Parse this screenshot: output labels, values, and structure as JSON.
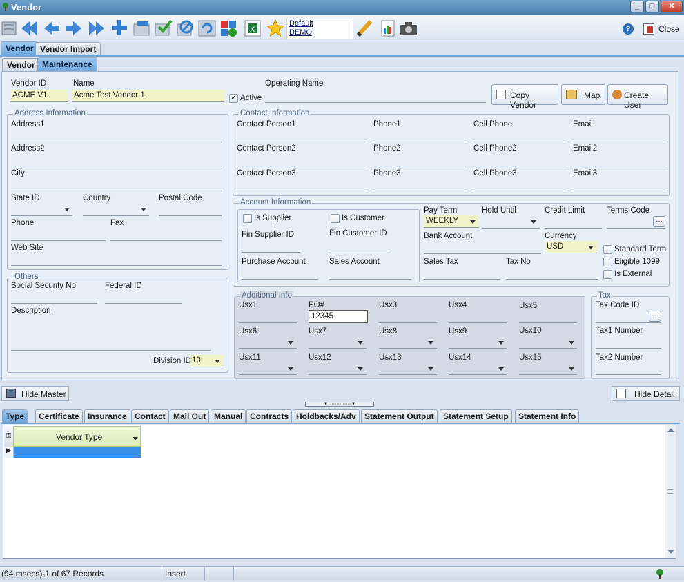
{
  "window": {
    "title": "Vendor"
  },
  "toolbar": {
    "icons": [
      "save-icon",
      "first-record-icon",
      "previous-record-icon",
      "next-record-icon",
      "last-record-icon",
      "add-record-icon",
      "delete-record-icon",
      "post-icon",
      "cancel-icon",
      "refresh-icon",
      "layout-icon",
      "excel-icon",
      "favorite-star-icon",
      "edit-pencil-icon",
      "report-icon",
      "camera-icon"
    ],
    "profile_line1": "Default",
    "profile_line2": "DEMO",
    "close_label": "Close"
  },
  "tabs_top": [
    "Vendor",
    "Vendor Import"
  ],
  "tabs_sub": [
    "Vendor",
    "Maintenance"
  ],
  "header": {
    "vendor_id_label": "Vendor ID",
    "vendor_id_value": "ACME V1",
    "name_label": "Name",
    "name_value": "Acme Test Vendor 1",
    "active_label": "Active",
    "operating_name_label": "Operating Name",
    "copy_vendor": "Copy Vendor",
    "map": "Map",
    "create_user": "Create User"
  },
  "address": {
    "title": "Address Information",
    "address1": "Address1",
    "address2": "Address2",
    "city": "City",
    "state": "State ID",
    "country": "Country",
    "postal": "Postal Code",
    "phone": "Phone",
    "fax": "Fax",
    "website": "Web Site"
  },
  "contact": {
    "title": "Contact Information",
    "rows": [
      [
        "Contact Person1",
        "Phone1",
        "Cell Phone",
        "Email"
      ],
      [
        "Contact Person2",
        "Phone2",
        "Cell Phone2",
        "Email2"
      ],
      [
        "Contact Person3",
        "Phone3",
        "Cell Phone3",
        "Email3"
      ]
    ]
  },
  "account": {
    "title": "Account Information",
    "is_supplier": "Is Supplier",
    "is_customer": "Is Customer",
    "fin_supplier": "Fin Supplier ID",
    "fin_customer": "Fin Customer ID",
    "purchase_account": "Purchase Account",
    "sales_account": "Sales Account",
    "pay_term": "Pay Term",
    "pay_term_value": "WEEKLY",
    "hold_until": "Hold Until",
    "credit_limit": "Credit Limit",
    "terms_code": "Terms Code",
    "bank_account": "Bank Account",
    "currency": "Currency",
    "currency_value": "USD",
    "sales_tax": "Sales Tax",
    "tax_no": "Tax No",
    "standard_term": "Standard Term",
    "eligible_1099": "Eligible 1099",
    "is_external": "Is External"
  },
  "others": {
    "title": "Others",
    "ssn": "Social Security No",
    "federal_id": "Federal  ID",
    "description": "Description",
    "division_label": "Division ID",
    "division_value": "10"
  },
  "additional": {
    "title": "Additional Info",
    "row1": [
      "Usx1",
      "PO#",
      "Usx3",
      "Usx4",
      "Usx5"
    ],
    "po_value": "12345",
    "row2": [
      "Usx6",
      "Usx7",
      "Usx8",
      "Usx9",
      "Usx10"
    ],
    "row3": [
      "Usx11",
      "Usx12",
      "Usx13",
      "Usx14",
      "Usx15"
    ]
  },
  "tax": {
    "title": "Tax",
    "tax_code": "Tax Code ID",
    "tax1": "Tax1 Number",
    "tax2": "Tax2 Number"
  },
  "bars": {
    "hide_master": "Hide Master",
    "hide_detail": "Hide Detail"
  },
  "bottom_tabs": [
    "Type",
    "Certificate",
    "Insurance",
    "Contact",
    "Mail Out",
    "Manual",
    "Contracts",
    "Holdbacks/Adv",
    "Statement Output",
    "Statement Setup",
    "Statement Info"
  ],
  "grid": {
    "column": "Vendor Type"
  },
  "status": {
    "records": "(94 msecs)-1 of 67 Records",
    "mode": "Insert"
  }
}
